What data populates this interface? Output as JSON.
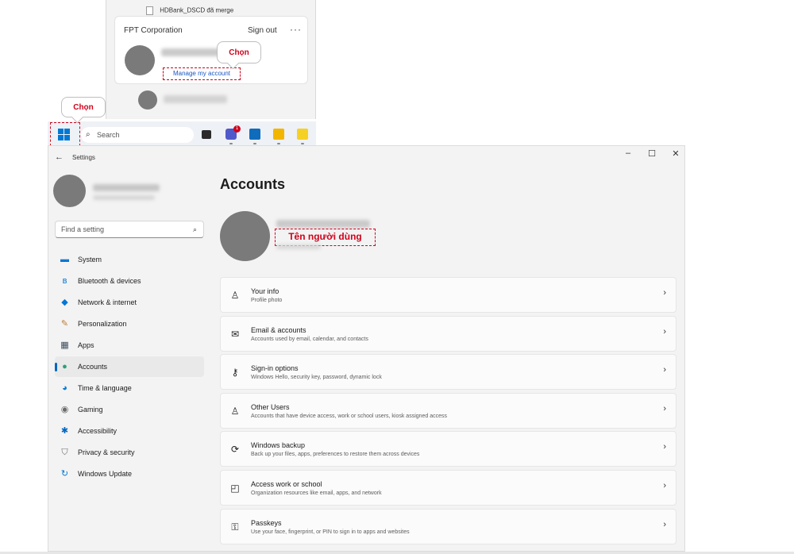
{
  "start_menu": {
    "file_name": "HDBank_DSCD đã merge",
    "organization": "FPT Corporation",
    "sign_out": "Sign out",
    "more": "···",
    "manage_account": "Manage my account",
    "callout": "Chọn"
  },
  "taskbar": {
    "search_placeholder": "Search",
    "teams_badge": "1",
    "start_callout": "Chọn"
  },
  "window": {
    "title": "Settings",
    "minimize": "–",
    "maximize": "☐",
    "close": "✕",
    "search_placeholder": "Find a setting"
  },
  "nav": {
    "items": [
      {
        "label": "System",
        "icon": "monitor-icon",
        "color": "#0078d4"
      },
      {
        "label": "Bluetooth & devices",
        "icon": "bluetooth-icon",
        "color": "#0078d4"
      },
      {
        "label": "Network & internet",
        "icon": "wifi-icon",
        "color": "#0078d4"
      },
      {
        "label": "Personalization",
        "icon": "brush-icon",
        "color": "#c07a32"
      },
      {
        "label": "Apps",
        "icon": "apps-icon",
        "color": "#3b4a5c"
      },
      {
        "label": "Accounts",
        "icon": "person-icon",
        "color": "#2aa179"
      },
      {
        "label": "Time & language",
        "icon": "globe-icon",
        "color": "#0078d4"
      },
      {
        "label": "Gaming",
        "icon": "gamepad-icon",
        "color": "#6b6b6b"
      },
      {
        "label": "Accessibility",
        "icon": "accessibility-icon",
        "color": "#0067c0"
      },
      {
        "label": "Privacy & security",
        "icon": "shield-icon",
        "color": "#6b6b6b"
      },
      {
        "label": "Windows Update",
        "icon": "update-icon",
        "color": "#0078d4"
      }
    ],
    "active": "Accounts"
  },
  "main": {
    "title": "Accounts",
    "username_annotation": "Tên người dùng",
    "options": [
      {
        "title": "Your info",
        "desc": "Profile photo",
        "icon": "user-info-icon"
      },
      {
        "title": "Email & accounts",
        "desc": "Accounts used by email, calendar, and contacts",
        "icon": "mail-icon"
      },
      {
        "title": "Sign-in options",
        "desc": "Windows Hello, security key, password, dynamic lock",
        "icon": "key-icon"
      },
      {
        "title": "Other Users",
        "desc": "Accounts that have device access, work or school users, kiosk assigned access",
        "icon": "add-user-icon"
      },
      {
        "title": "Windows backup",
        "desc": "Back up your files, apps, preferences to restore them across devices",
        "icon": "backup-icon"
      },
      {
        "title": "Access work or school",
        "desc": "Organization resources like email, apps, and network",
        "icon": "briefcase-icon"
      },
      {
        "title": "Passkeys",
        "desc": "Use your face, fingerprint, or PIN to sign in to apps and websites",
        "icon": "passkey-icon"
      }
    ]
  }
}
